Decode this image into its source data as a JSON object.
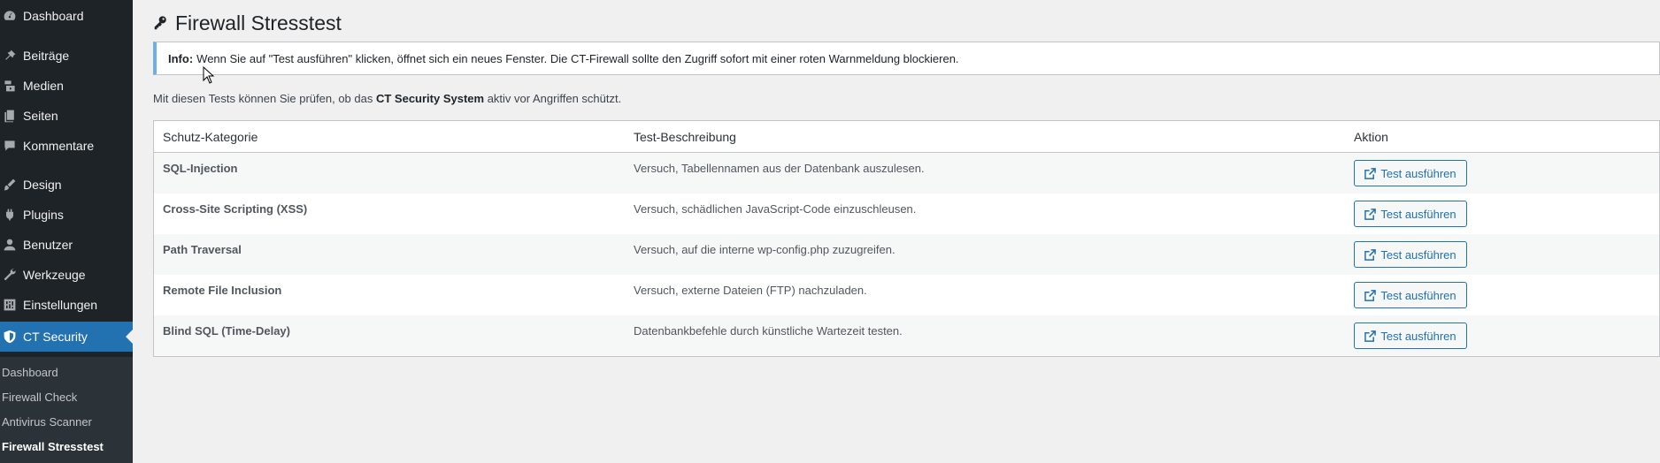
{
  "sidebar": {
    "items": [
      {
        "label": "Dashboard",
        "icon": "dashboard-icon"
      },
      {
        "label": "Beiträge",
        "icon": "pin-icon"
      },
      {
        "label": "Medien",
        "icon": "media-icon"
      },
      {
        "label": "Seiten",
        "icon": "pages-icon"
      },
      {
        "label": "Kommentare",
        "icon": "comments-icon"
      },
      {
        "label": "Design",
        "icon": "brush-icon"
      },
      {
        "label": "Plugins",
        "icon": "plugin-icon"
      },
      {
        "label": "Benutzer",
        "icon": "user-icon"
      },
      {
        "label": "Werkzeuge",
        "icon": "wrench-icon"
      },
      {
        "label": "Einstellungen",
        "icon": "settings-icon"
      },
      {
        "label": "CT Security",
        "icon": "shield-icon"
      }
    ],
    "submenu": [
      "Dashboard",
      "Firewall Check",
      "Antivirus Scanner",
      "Firewall Stresstest"
    ]
  },
  "page": {
    "title": "Firewall Stresstest",
    "notice_label": "Info:",
    "notice_text": "Wenn Sie auf \"Test ausführen\" klicken, öffnet sich ein neues Fenster. Die CT-Firewall sollte den Zugriff sofort mit einer roten Warnmeldung blockieren.",
    "intro_before": "Mit diesen Tests können Sie prüfen, ob das ",
    "intro_bold": "CT Security System",
    "intro_after": " aktiv vor Angriffen schützt."
  },
  "table": {
    "headers": [
      "Schutz-Kategorie",
      "Test-Beschreibung",
      "Aktion"
    ],
    "rows": [
      {
        "category": "SQL-Injection",
        "description": "Versuch, Tabellennamen aus der Datenbank auszulesen.",
        "action": "Test ausführen"
      },
      {
        "category": "Cross-Site Scripting (XSS)",
        "description": "Versuch, schädlichen JavaScript-Code einzuschleusen.",
        "action": "Test ausführen"
      },
      {
        "category": "Path Traversal",
        "description": "Versuch, auf die interne wp-config.php zuzugreifen.",
        "action": "Test ausführen"
      },
      {
        "category": "Remote File Inclusion",
        "description": "Versuch, externe Dateien (FTP) nachzuladen.",
        "action": "Test ausführen"
      },
      {
        "category": "Blind SQL (Time-Delay)",
        "description": "Datenbankbefehle durch künstliche Wartezeit testen.",
        "action": "Test ausführen"
      }
    ]
  },
  "colors": {
    "sidebar_bg": "#1d2327",
    "submenu_bg": "#2c3338",
    "accent": "#2271b1",
    "notice_border": "#72aee6"
  }
}
